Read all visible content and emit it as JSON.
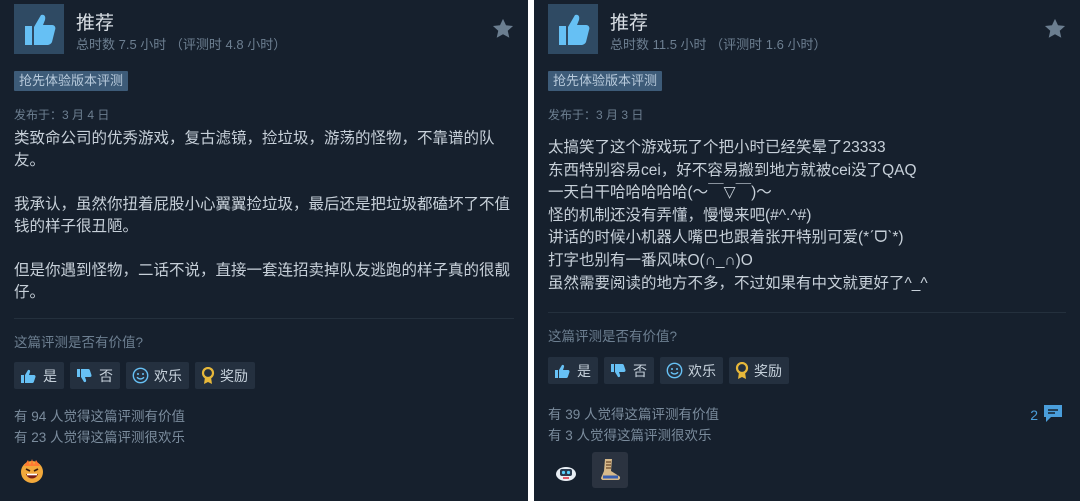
{
  "left": {
    "recommendation": "推荐",
    "hours": "总时数 7.5 小时 （评测时 4.8 小时）",
    "early_access_tag": "抢先体验版本评测",
    "posted": "发布于：3 月 4 日",
    "paragraphs": [
      "类致命公司的优秀游戏，复古滤镜，捡垃圾，游荡的怪物，不靠谱的队友。",
      "我承认，虽然你扭着屁股小心翼翼捡垃圾，最后还是把垃圾都磕坏了不值钱的样子很丑陋。",
      "但是你遇到怪物，二话不说，直接一套连招卖掉队友逃跑的样子真的很靓仔。"
    ],
    "helpful_question": "这篇评测是否有价值?",
    "buttons": {
      "yes": "是",
      "no": "否",
      "funny": "欢乐",
      "award": "奖励"
    },
    "helpful_count": "有 94 人觉得这篇评测有价值",
    "funny_count": "有 23 人觉得这篇评测很欢乐",
    "award_icons": [
      "laughing-face-award"
    ]
  },
  "right": {
    "recommendation": "推荐",
    "hours": "总时数 11.5 小时 （评测时 1.6 小时）",
    "early_access_tag": "抢先体验版本评测",
    "posted": "发布于：3 月 3 日",
    "lines": [
      "太搞笑了这个游戏玩了个把小时已经笑晕了23333",
      "东西特别容易cei，好不容易搬到地方就被cei没了QAQ",
      "一天白干哈哈哈哈哈(～￣▽￣)～",
      "怪的机制还没有弄懂，慢慢来吧(#^.^#)",
      "讲话的时候小机器人嘴巴也跟着张开特别可爱(*ˊᗜˋ*)",
      "打字也别有一番风味O(∩_∩)O",
      "虽然需要阅读的地方不多，不过如果有中文就更好了^_^"
    ],
    "helpful_question": "这篇评测是否有价值?",
    "buttons": {
      "yes": "是",
      "no": "否",
      "funny": "欢乐",
      "award": "奖励"
    },
    "helpful_count": "有 39 人觉得这篇评测有价值",
    "funny_count": "有 3 人觉得这篇评测很欢乐",
    "comment_count": "2",
    "award_icons": [
      "robot-award",
      "boot-award"
    ]
  },
  "colors": {
    "card_bg": "#16202d",
    "tag_bg": "#3d5b78",
    "button_bg": "#24303f",
    "link_blue": "#4a9edb",
    "award_gold": "#e7b83a"
  }
}
